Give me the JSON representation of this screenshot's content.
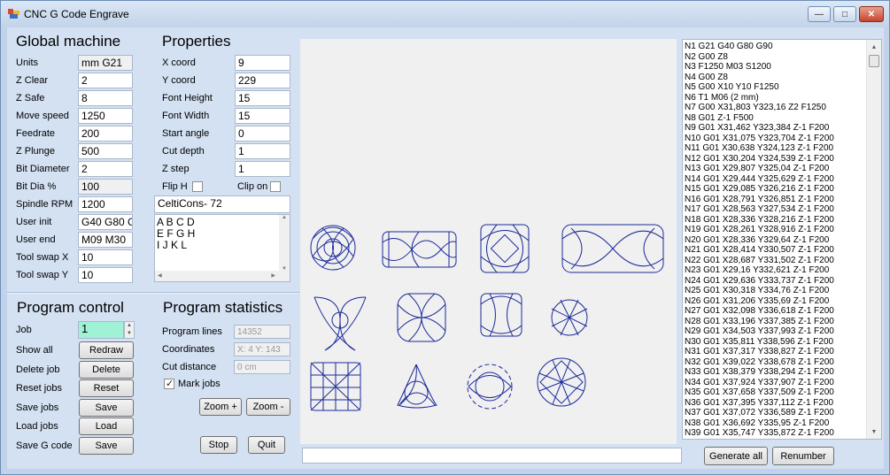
{
  "window": {
    "title": "CNC G Code Engrave",
    "controls": {
      "minimize": "—",
      "maximize": "□",
      "close": "✕"
    }
  },
  "global_machine": {
    "heading": "Global machine",
    "fields": [
      {
        "label": "Units",
        "value": "mm G21"
      },
      {
        "label": "Z Clear",
        "value": "2"
      },
      {
        "label": "Z Safe",
        "value": "8"
      },
      {
        "label": "Move speed",
        "value": "1250"
      },
      {
        "label": "Feedrate",
        "value": "200"
      },
      {
        "label": "Z Plunge",
        "value": "500"
      },
      {
        "label": "Bit Diameter",
        "value": "2"
      },
      {
        "label": "Bit Dia %",
        "value": "100"
      },
      {
        "label": "Spindle RPM",
        "value": "1200"
      },
      {
        "label": "User init",
        "value": "G40 G80 G"
      },
      {
        "label": "User end",
        "value": "M09 M30"
      },
      {
        "label": "Tool swap X",
        "value": "10"
      },
      {
        "label": "Tool swap Y",
        "value": "10"
      }
    ]
  },
  "properties": {
    "heading": "Properties",
    "fields": [
      {
        "label": "X coord",
        "value": "9"
      },
      {
        "label": "Y coord",
        "value": "229"
      },
      {
        "label": "Font Height",
        "value": "15"
      },
      {
        "label": "Font Width",
        "value": "15"
      },
      {
        "label": "Start angle",
        "value": "0"
      },
      {
        "label": "Cut depth",
        "value": "1"
      },
      {
        "label": "Z step",
        "value": "1"
      }
    ],
    "flip_h_label": "Flip H",
    "clip_on_label": "Clip on",
    "font_value": "CeltiCons- 72",
    "text_lines": [
      "A B C D",
      "E F G H",
      "I J K L"
    ]
  },
  "program_control": {
    "heading": "Program control",
    "job_label": "Job",
    "job_value": "1",
    "rows": [
      {
        "label": "Show all",
        "button": "Redraw"
      },
      {
        "label": "Delete job",
        "button": "Delete"
      },
      {
        "label": "Reset jobs",
        "button": "Reset"
      },
      {
        "label": "Save jobs",
        "button": "Save"
      },
      {
        "label": "Load jobs",
        "button": "Load"
      },
      {
        "label": "Save G code",
        "button": "Save"
      }
    ]
  },
  "program_statistics": {
    "heading": "Program statistics",
    "fields": [
      {
        "label": "Program lines",
        "value": "14352"
      },
      {
        "label": "Coordinates",
        "value": "X: 4  Y: 143"
      },
      {
        "label": "Cut distance",
        "value": "0 cm"
      }
    ],
    "mark_jobs_label": "Mark jobs",
    "zoom_in": "Zoom +",
    "zoom_out": "Zoom -",
    "stop": "Stop",
    "quit": "Quit"
  },
  "gcode_lines": [
    "N1 G21 G40 G80 G90",
    "N2 G00 Z8",
    "N3  F1250 M03 S1200",
    "N4 G00 Z8",
    "N5 G00 X10 Y10 F1250",
    "N6 T1 M06 (2 mm)",
    "N7 G00 X31,803 Y323,16 Z2 F1250",
    "N8 G01 Z-1 F500",
    "N9 G01 X31,462 Y323,384 Z-1 F200",
    "N10 G01 X31,075 Y323,704 Z-1 F200",
    "N11 G01 X30,638 Y324,123 Z-1 F200",
    "N12 G01 X30,204 Y324,539 Z-1 F200",
    "N13 G01 X29,807 Y325,04 Z-1 F200",
    "N14 G01 X29,444 Y325,629 Z-1 F200",
    "N15 G01 X29,085 Y326,216 Z-1 F200",
    "N16 G01 X28,791 Y326,851 Z-1 F200",
    "N17 G01 X28,563 Y327,534 Z-1 F200",
    "N18 G01 X28,336 Y328,216 Z-1 F200",
    "N19 G01 X28,261 Y328,916 Z-1 F200",
    "N20 G01 X28,336 Y329,64 Z-1 F200",
    "N21 G01 X28,414 Y330,507 Z-1 F200",
    "N22 G01 X28,687 Y331,502 Z-1 F200",
    "N23 G01 X29,16 Y332,621 Z-1 F200",
    "N24 G01 X29,636 Y333,737 Z-1 F200",
    "N25 G01 X30,318 Y334,76 Z-1 F200",
    "N26 G01 X31,206 Y335,69 Z-1 F200",
    "N27 G01 X32,098 Y336,618 Z-1 F200",
    "N28 G01 X33,196 Y337,385 Z-1 F200",
    "N29 G01 X34,503 Y337,993 Z-1 F200",
    "N30 G01 X35,811 Y338,596 Z-1 F200",
    "N31 G01 X37,317 Y338,827 Z-1 F200",
    "N32 G01 X39,022 Y338,678 Z-1 F200",
    "N33 G01 X38,379 Y338,294 Z-1 F200",
    "N34 G01 X37,924 Y337,907 Z-1 F200",
    "N35 G01 X37,658 Y337,509 Z-1 F200",
    "N36 G01 X37,395 Y337,112 Z-1 F200",
    "N37 G01 X37,072 Y336,589 Z-1 F200",
    "N38 G01 X36,692 Y335,95 Z-1 F200",
    "N39 G01 X35,747 Y335,872 Z-1 F200"
  ],
  "bottom": {
    "status_value": "",
    "generate_all": "Generate all",
    "renumber": "Renumber"
  },
  "colors": {
    "knot_stroke": "#1a2a9a",
    "job_highlight": "#9ff2d6",
    "accent": "#c2d3e9"
  }
}
